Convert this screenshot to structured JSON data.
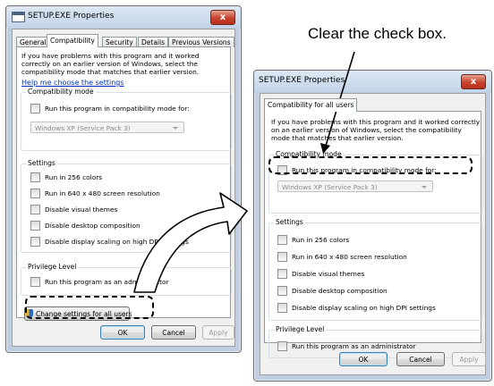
{
  "callout": {
    "text": "Clear the check box."
  },
  "dialog1": {
    "title": "SETUP.EXE Properties",
    "close_label": "x",
    "tabs": [
      {
        "label": "General"
      },
      {
        "label": "Compatibility"
      },
      {
        "label": "Security"
      },
      {
        "label": "Details"
      },
      {
        "label": "Previous Versions"
      }
    ],
    "description": "If you have problems with this program and it worked correctly on an earlier version of Windows, select the compatibility mode that matches that earlier version.",
    "help_link": "Help me choose the settings",
    "compat_group": "Compatibility mode",
    "compat_checkbox": "Run this program in compatibility mode for:",
    "compat_select": "Windows XP (Service Pack 3)",
    "settings_group": "Settings",
    "settings": [
      {
        "label": "Run in 256 colors"
      },
      {
        "label": "Run in 640 x 480 screen resolution"
      },
      {
        "label": "Disable visual themes"
      },
      {
        "label": "Disable desktop composition"
      },
      {
        "label": "Disable display scaling on high DPI settings"
      }
    ],
    "privilege_group": "Privilege Level",
    "privilege_checkbox": "Run this program as an administrator",
    "change_all_users": "Change settings for all users",
    "ok": "OK",
    "cancel": "Cancel",
    "apply": "Apply"
  },
  "dialog2": {
    "title": "SETUP.EXE Properties",
    "close_label": "x",
    "tab": "Compatibility for all users",
    "description": "If you have problems with this program and it worked correctly on an earlier version of Windows, select the compatibility mode that matches that earlier version.",
    "compat_group": "Compatibility mode",
    "compat_checkbox": "Run this program in compatibility mode for:",
    "compat_select": "Windows XP (Service Pack 3)",
    "settings_group": "Settings",
    "settings": [
      {
        "label": "Run in 256 colors"
      },
      {
        "label": "Run in 640 x 480 screen resolution"
      },
      {
        "label": "Disable visual themes"
      },
      {
        "label": "Disable desktop composition"
      },
      {
        "label": "Disable display scaling on high DPI settings"
      }
    ],
    "privilege_group": "Privilege Level",
    "privilege_checkbox": "Run this program as an administrator",
    "ok": "OK",
    "cancel": "Cancel",
    "apply": "Apply"
  }
}
